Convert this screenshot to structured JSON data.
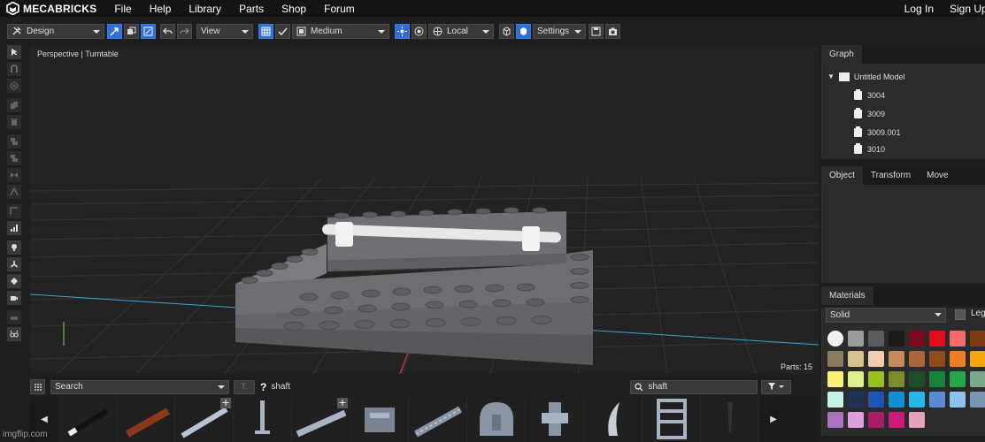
{
  "brand": {
    "name": "MECABRICKS"
  },
  "nav": {
    "items": [
      "File",
      "Help",
      "Library",
      "Parts",
      "Shop",
      "Forum"
    ],
    "login": "Log In",
    "signup": "Sign Up"
  },
  "toolbar": {
    "mode": "Design",
    "view": "View",
    "quality": "Medium",
    "space": "Local",
    "settings": "Settings"
  },
  "viewport": {
    "label": "Perspective | Turntable",
    "parts_count": "Parts: 15"
  },
  "graph": {
    "tab": "Graph",
    "root": "Untitled Model",
    "children": [
      "3004",
      "3009",
      "3009.001",
      "3010"
    ]
  },
  "object_panel": {
    "tabs": [
      "Object",
      "Transform",
      "Move"
    ]
  },
  "materials": {
    "tab": "Materials",
    "finish": "Solid",
    "legacy_label": "Leg",
    "colors": [
      "#f2f2f2",
      "#9b9b9b",
      "#5a5c63",
      "#1b1b1b",
      "#7b0c1f",
      "#e10d1f",
      "#f56a6a",
      "#7b3a10",
      "#8c7a5c",
      "#d8c08a",
      "#f5ccb0",
      "#c88a5c",
      "#a8673a",
      "#8e4b1c",
      "#f17e22",
      "#f5a60f",
      "#fff07a",
      "#e0ef8c",
      "#98c01e",
      "#7c8c2a",
      "#1e4d2a",
      "#18843a",
      "#25a84a",
      "#7aa88c",
      "#c8eee8",
      "#203458",
      "#1d56b4",
      "#1090d4",
      "#25b8e8",
      "#5a8cd4",
      "#8ac4ec",
      "#7a94b4",
      "#a874c0",
      "#e0a0e0",
      "#a81c6a",
      "#cc1a7a",
      "#e6a0c0"
    ]
  },
  "bottom": {
    "search_mode": "Search",
    "query": "shaft",
    "search_query": "shaft"
  },
  "watermark": "imgflip.com",
  "icons": {
    "select": "arrow-pointer-icon",
    "magnet": "magnet-icon",
    "target": "target-icon",
    "copy": "copy-icon",
    "trash": "trash-icon",
    "camera": "camera-icon",
    "eye": "glasses-icon",
    "light": "bulb-icon",
    "fan": "fan-icon"
  }
}
